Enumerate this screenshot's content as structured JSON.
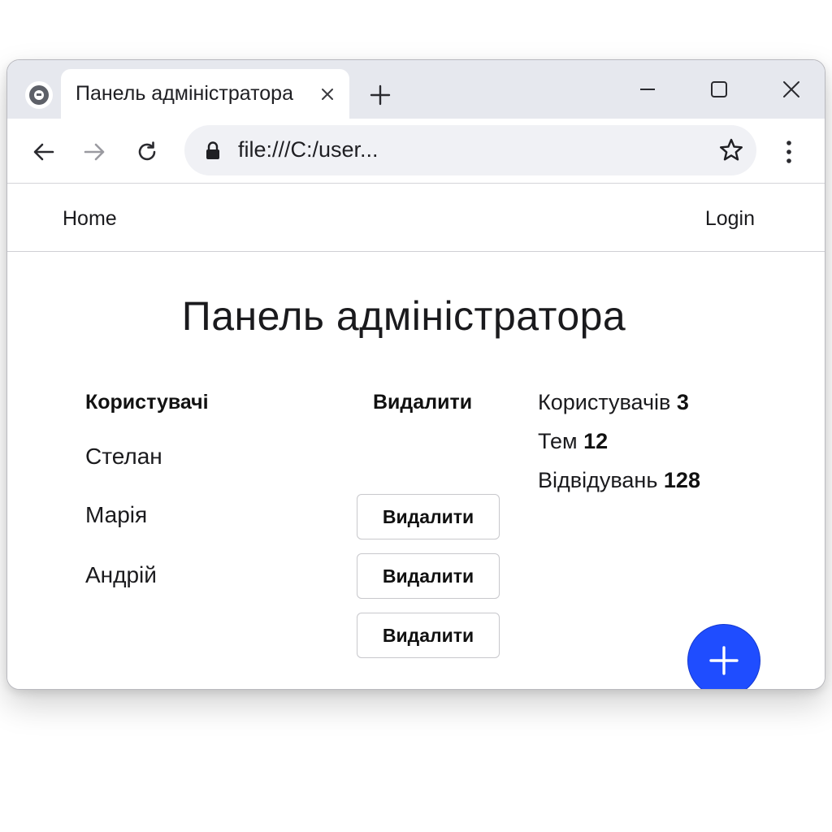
{
  "browser": {
    "tab_title": "Панель адміністратора",
    "url": "file:///C:/user..."
  },
  "icons": {
    "browser_logo": "browser-logo-icon",
    "tab_close": "close-icon",
    "new_tab": "plus-icon",
    "minimize": "minimize-icon",
    "maximize": "maximize-icon",
    "window_close": "close-icon",
    "back": "arrow-left-icon",
    "forward": "arrow-right-icon",
    "reload": "reload-icon",
    "lock": "lock-icon",
    "bookmark": "star-icon",
    "menu": "more-vertical-icon",
    "fab": "plus-icon"
  },
  "site_nav": {
    "home": "Home",
    "login": "Login"
  },
  "main": {
    "title": "Панель адміністратора",
    "table": {
      "headers": [
        "Користувачі",
        "Видалити"
      ],
      "rows": [
        {
          "name": "Стелан",
          "action": "Видалити"
        },
        {
          "name": "Марія",
          "action": "Видалити"
        },
        {
          "name": "Андрій",
          "action": "Видалити"
        }
      ]
    },
    "stats": [
      {
        "label": "Користувачів",
        "value": "3"
      },
      {
        "label": "Тем",
        "value": "12"
      },
      {
        "label": "Відвідувань",
        "value": "128"
      }
    ]
  },
  "colors": {
    "fab": "#1f4dff",
    "tabstrip": "#e6e8ee",
    "omnibox": "#f0f1f5"
  }
}
